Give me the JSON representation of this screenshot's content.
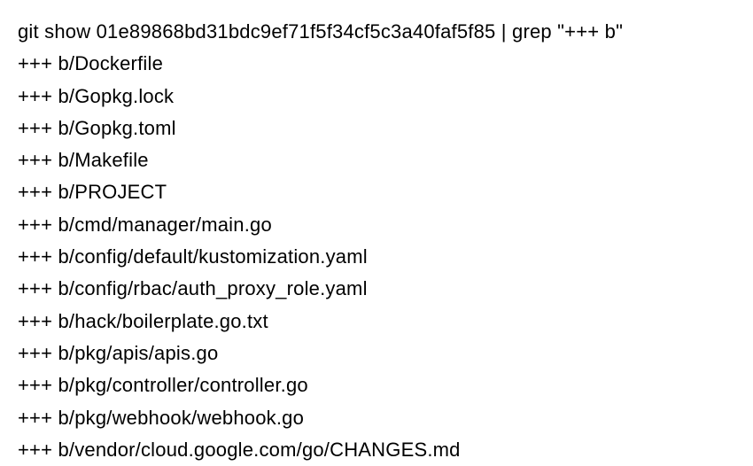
{
  "command": {
    "git_show": "git show 01e89868bd31bdc9ef71f5f34cf5c3a40faf5f85 | grep \"+++ b",
    "trailing_quote": "\""
  },
  "output_lines": [
    "+++ b/Dockerfile",
    "+++ b/Gopkg.lock",
    "+++ b/Gopkg.toml",
    "+++ b/Makefile",
    "+++ b/PROJECT",
    "+++ b/cmd/manager/main.go",
    "+++ b/config/default/kustomization.yaml",
    "+++ b/config/rbac/auth_proxy_role.yaml",
    "+++ b/hack/boilerplate.go.txt",
    "+++ b/pkg/apis/apis.go",
    "+++ b/pkg/controller/controller.go",
    "+++ b/pkg/webhook/webhook.go",
    "+++ b/vendor/cloud.google.com/go/CHANGES.md"
  ]
}
